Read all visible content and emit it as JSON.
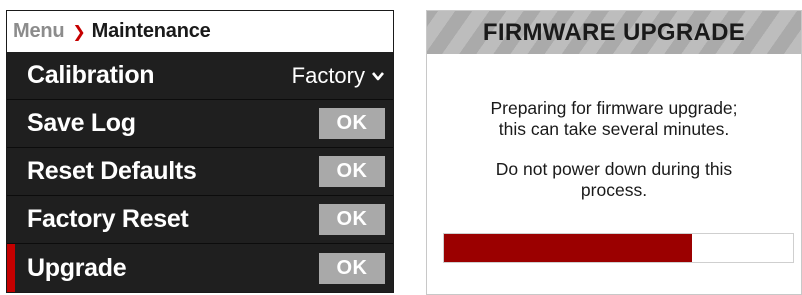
{
  "menu": {
    "breadcrumb": {
      "parent": "Menu",
      "separator": "❯",
      "current": "Maintenance"
    },
    "items": [
      {
        "label": "Calibration",
        "value": "Factory",
        "icon": "chevron-down-icon"
      },
      {
        "label": "Save Log",
        "button": "OK"
      },
      {
        "label": "Reset Defaults",
        "button": "OK"
      },
      {
        "label": "Factory Reset",
        "button": "OK"
      },
      {
        "label": "Upgrade",
        "button": "OK",
        "selected": true
      }
    ]
  },
  "firmware": {
    "title": "FIRMWARE UPGRADE",
    "message_line1": "Preparing for firmware upgrade;",
    "message_line2": "this can take several minutes.",
    "warning_line1": "Do not power down during this",
    "warning_line2": "process.",
    "progress_fraction": 0.71
  },
  "colors": {
    "accent_red": "#c40000",
    "progress_red": "#9b0000",
    "row_bg": "#1f1f1f",
    "ok_button_bg": "#a9a9a9"
  }
}
